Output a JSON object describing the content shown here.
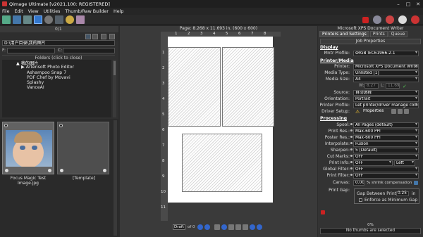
{
  "window": {
    "title": "Qimage Ultimate [v2021.100: REGISTERED]",
    "minimize": "–",
    "maximize": "□",
    "close": "✕"
  },
  "menu": [
    "File",
    "Edit",
    "View",
    "Utilities",
    "Thumb/Raw Builder",
    "Help"
  ],
  "left": {
    "page_indicator": "0/1",
    "path": "D:\\用户目录\\我的图片",
    "filter_label": "F:",
    "filter_label2": "C:",
    "folders_header": "Folders (click to close)",
    "tree": [
      {
        "label": "▲ 我的图片",
        "indent": 1,
        "selected": true
      },
      {
        "label": "▶ Artensoft Photo Editor",
        "indent": 2
      },
      {
        "label": "Ashampoo Snap 7",
        "indent": 3
      },
      {
        "label": "PDF Chef by Movavi",
        "indent": 3
      },
      {
        "label": "Splashy",
        "indent": 3
      },
      {
        "label": "VanceAI",
        "indent": 3
      }
    ],
    "thumbs": [
      {
        "caption": "Focus Magic Test Image.jpg"
      },
      {
        "caption": "[Template]"
      }
    ]
  },
  "center": {
    "page_info": "Page: 8.268 x 11.693 in.  (600 x 600)",
    "ruler_top": [
      "1",
      "2",
      "3",
      "4",
      "5",
      "6",
      "7",
      "8"
    ],
    "ruler_left": [
      "1",
      "2",
      "3",
      "4",
      "5",
      "6",
      "7",
      "8",
      "9",
      "10",
      "11"
    ],
    "bottom": {
      "mode": "Draft",
      "of": "of 0"
    }
  },
  "right": {
    "printer_header": "Microsoft XPS Document Writer",
    "tabs": [
      "Printers and Settings",
      "Prints",
      "Queue"
    ],
    "job_properties": "Job Properties",
    "sections": {
      "display": "Display",
      "printer_media": "Printer/Media",
      "processing": "Processing"
    },
    "rows": {
      "mntr_profile": {
        "label": "Mntr Profile:",
        "value": "sRGB IEC61966-2.1"
      },
      "printer": {
        "label": "Printer:",
        "value": "Microsoft XPS Document Writer"
      },
      "media_type": {
        "label": "Media Type:",
        "value": "Unlisted [1]"
      },
      "media_size": {
        "label": "Media Size:",
        "value": "A4"
      },
      "width": {
        "label": "W:",
        "value": "8.27"
      },
      "length": {
        "label": "L:",
        "value": "11.69"
      },
      "source": {
        "label": "Source:",
        "value": "自动选择"
      },
      "orientation": {
        "label": "Orientation:",
        "value": "Portrait"
      },
      "printer_profile": {
        "label": "Printer Profile:",
        "value": "Let printer/driver manage color"
      },
      "driver_setup": {
        "label": "Driver Setup:",
        "value": "Properties"
      },
      "spool": {
        "label": "Spool:",
        "value": "All Pages (default)"
      },
      "print_res": {
        "label": "Print Res.:",
        "value": "Max-600 PPI"
      },
      "poster_res": {
        "label": "Poster Res.:",
        "value": "Max-600 PPI"
      },
      "interpolate": {
        "label": "Interpolate:",
        "value": "Fusion"
      },
      "sharpen": {
        "label": "Sharpen:",
        "value": "5 (Default)"
      },
      "cut_marks": {
        "label": "Cut Marks:",
        "value": "OFF"
      },
      "print_info": {
        "label": "Print Info:",
        "value": "OFF",
        "position": "Left"
      },
      "global_filter": {
        "label": "Global Filter:",
        "value": "OFF"
      },
      "print_filter": {
        "label": "Print Filter:",
        "value": "OFF"
      },
      "canvas": {
        "label": "Canvas:",
        "value": "0.00",
        "suffix": "% shrink compensation"
      },
      "print_gap": {
        "label": "Print Gap:"
      }
    },
    "gap": {
      "label": "Gap Between Prints",
      "value": "0.25",
      "unit": "in",
      "enforce": "Enforce as Minimum Gap"
    },
    "progress": "0%",
    "nothumbs": "No thumbs are selected"
  },
  "colors": {
    "accent_red": "#cc2222",
    "bg_dark": "#2b2b2b",
    "panel": "#333333",
    "selection_blue": "#3377cc"
  }
}
